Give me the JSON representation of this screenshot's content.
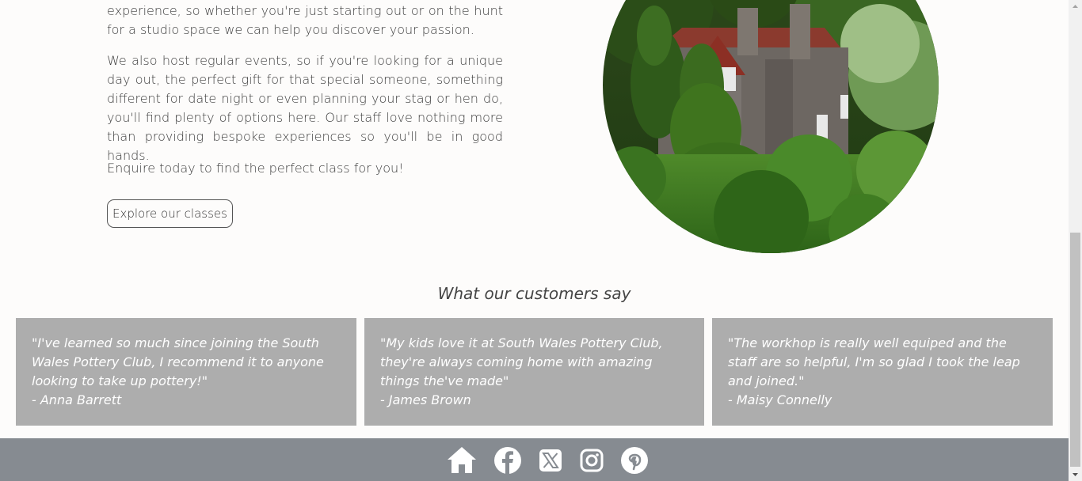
{
  "intro": {
    "paragraph1": "experience, so whether you're just starting out or on the hunt for a studio space we can help you discover your passion.",
    "paragraph2": "We also host regular events, so if you're looking for a unique day out, the perfect gift for that special someone, something different for date night or even planning your stag or hen do, you'll find plenty of options here. Our staff love nothing more than providing bespoke experiences so you'll be in good hands.",
    "paragraph3": "Enquire today to find the perfect class for you!",
    "button_label": "Explore our classes"
  },
  "testimonials": {
    "title": "What our customers say",
    "items": [
      {
        "quote": "\"I've learned so much since joining the South Wales Pottery Club, I recommend it to anyone looking to take up pottery!\"",
        "author": "- Anna Barrett"
      },
      {
        "quote": "\"My kids love it at South Wales Pottery Club, they're always coming home with amazing things the've made\"",
        "author": "- James Brown"
      },
      {
        "quote": "\"The workhop is really well equiped and the staff are so helpful, I'm so glad I took the leap and joined.\"",
        "author": "- Maisy Connelly"
      }
    ]
  },
  "footer": {
    "icons": [
      "home-icon",
      "facebook-icon",
      "x-twitter-icon",
      "instagram-icon",
      "pinterest-icon"
    ]
  },
  "colors": {
    "card_bg": "#adadad",
    "footer_bg": "#868b91",
    "page_bg": "#fdfcfb"
  }
}
